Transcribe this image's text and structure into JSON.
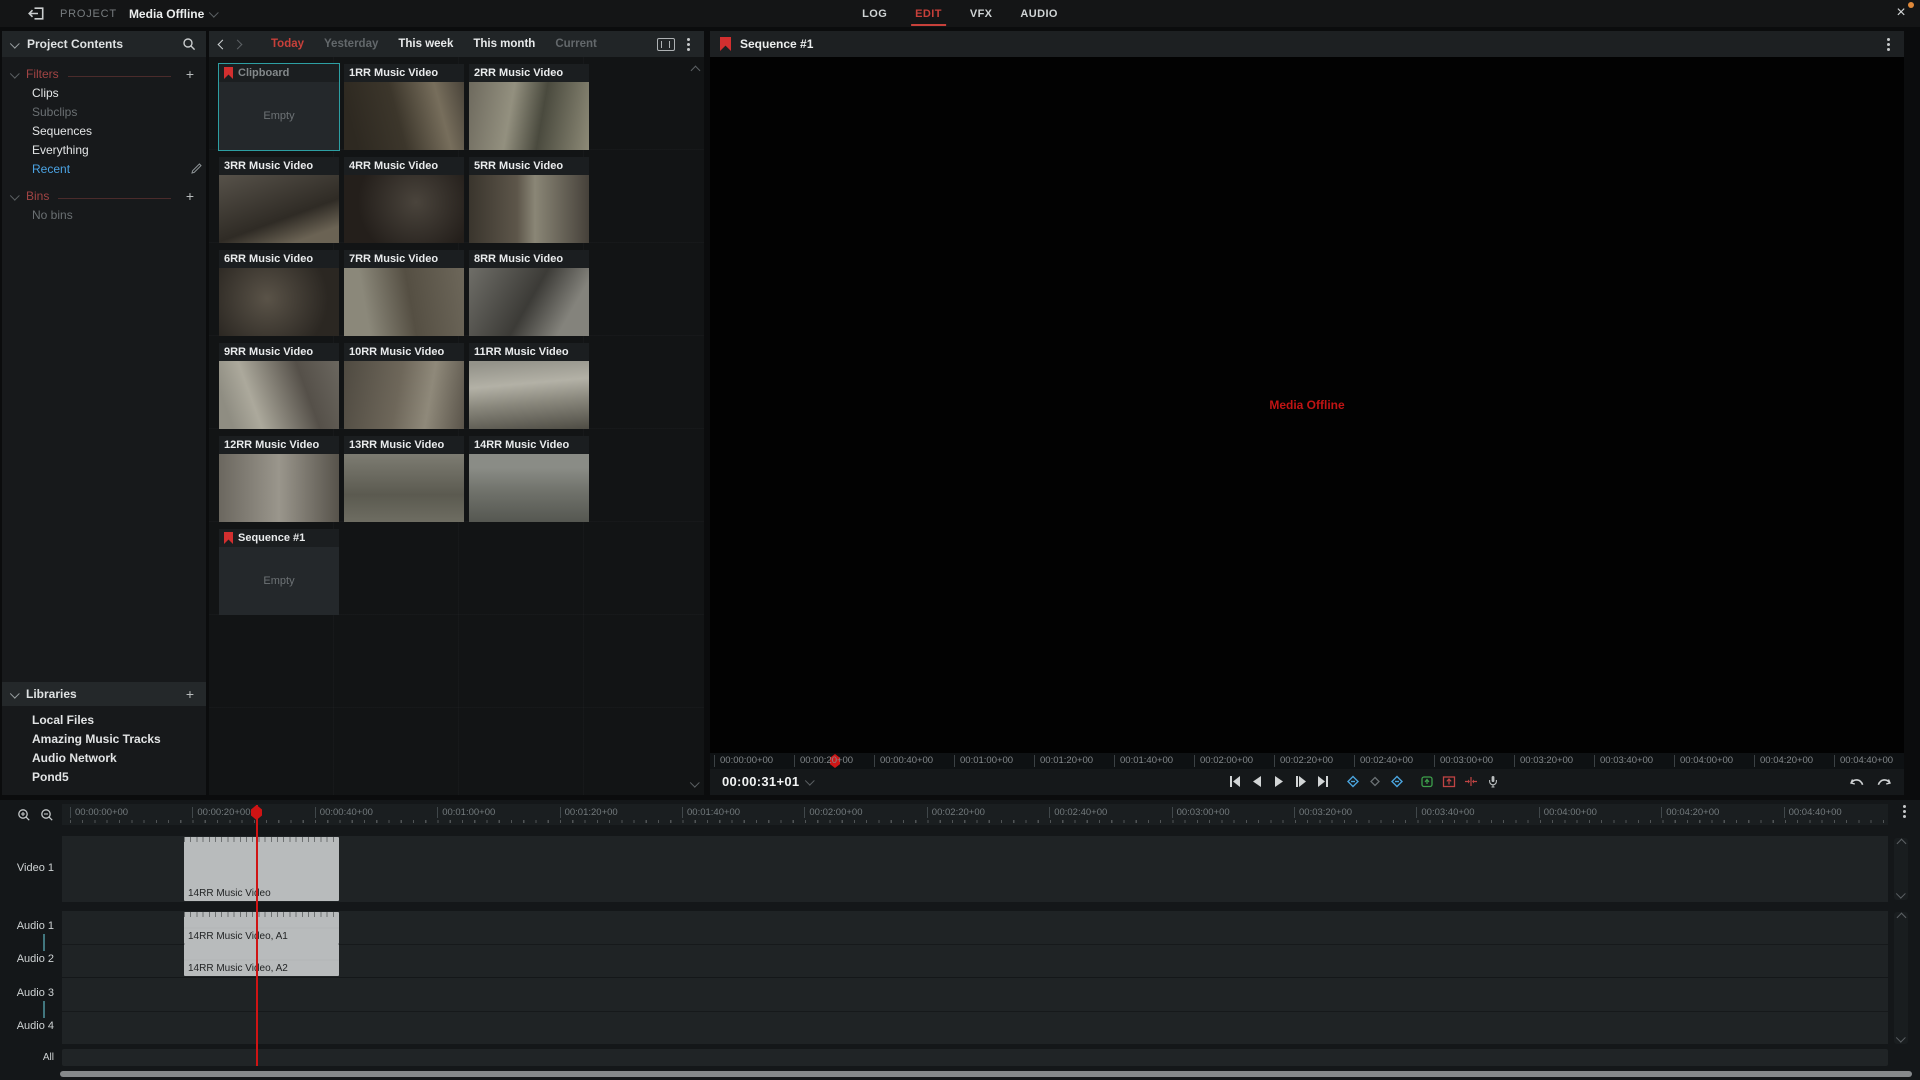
{
  "colors": {
    "accent_red": "#c7403a",
    "bookmark_red": "#d22f2f",
    "selected_teal": "#2d9fa3",
    "recent_blue": "#4ba3e3",
    "offline_red": "#c01414",
    "playhead_red": "#cf1414",
    "notification_orange": "#e0893a"
  },
  "topbar": {
    "project_label": "PROJECT",
    "project_name": "Media Offline",
    "tabs": [
      {
        "label": "LOG",
        "state": "normal"
      },
      {
        "label": "EDIT",
        "state": "active"
      },
      {
        "label": "VFX",
        "state": "normal"
      },
      {
        "label": "AUDIO",
        "state": "normal"
      }
    ],
    "close_label": "×"
  },
  "sidebar": {
    "title": "Project Contents",
    "filters": {
      "title": "Filters",
      "items": [
        {
          "label": "Clips",
          "state": "normal"
        },
        {
          "label": "Subclips",
          "state": "dim"
        },
        {
          "label": "Sequences",
          "state": "normal"
        },
        {
          "label": "Everything",
          "state": "normal"
        },
        {
          "label": "Recent",
          "state": "selected"
        }
      ]
    },
    "bins": {
      "title": "Bins",
      "empty_label": "No bins"
    },
    "libraries": {
      "title": "Libraries",
      "items": [
        "Local Files",
        "Amazing Music Tracks",
        "Audio Network",
        "Pond5"
      ]
    }
  },
  "browser": {
    "tabs": [
      {
        "label": "Today",
        "state": "active"
      },
      {
        "label": "Yesterday",
        "state": "dim"
      },
      {
        "label": "This week",
        "state": "normal"
      },
      {
        "label": "This month",
        "state": "normal"
      },
      {
        "label": "Current",
        "state": "dim"
      }
    ],
    "tiles": [
      {
        "title": "Clipboard",
        "kind": "empty",
        "selected": true,
        "bookmark": true,
        "empty_label": "Empty"
      },
      {
        "title": "1RR Music Video",
        "kind": "clip",
        "thumb": 1
      },
      {
        "title": "2RR Music Video",
        "kind": "clip",
        "thumb": 2
      },
      {
        "title": "3RR Music Video",
        "kind": "clip",
        "thumb": 3
      },
      {
        "title": "4RR Music Video",
        "kind": "clip",
        "thumb": 4
      },
      {
        "title": "5RR Music Video",
        "kind": "clip",
        "thumb": 5
      },
      {
        "title": "6RR Music Video",
        "kind": "clip",
        "thumb": 6
      },
      {
        "title": "7RR Music Video",
        "kind": "clip",
        "thumb": 7
      },
      {
        "title": "8RR Music Video",
        "kind": "clip",
        "thumb": 8
      },
      {
        "title": "9RR Music Video",
        "kind": "clip",
        "thumb": 9
      },
      {
        "title": "10RR Music Video",
        "kind": "clip",
        "thumb": 10
      },
      {
        "title": "11RR Music Video",
        "kind": "clip",
        "thumb": 11
      },
      {
        "title": "12RR Music Video",
        "kind": "clip",
        "thumb": 12
      },
      {
        "title": "13RR Music Video",
        "kind": "clip",
        "thumb": 13
      },
      {
        "title": "14RR Music Video",
        "kind": "clip",
        "thumb": 14
      },
      {
        "title": "Sequence #1",
        "kind": "empty",
        "selected": false,
        "bookmark": true,
        "empty_label": "Empty"
      }
    ]
  },
  "viewer": {
    "title": "Sequence #1",
    "offline_text": "Media Offline",
    "position_timecode": "00:00:31+01",
    "ruler_labels": [
      "00:00:00+00",
      "00:00:20+00",
      "00:00:40+00",
      "00:01:00+00",
      "00:01:20+00",
      "00:01:40+00",
      "00:02:00+00",
      "00:02:20+00",
      "00:02:40+00",
      "00:03:00+00",
      "00:03:20+00",
      "00:03:40+00",
      "00:04:00+00",
      "00:04:20+00",
      "00:04:40+00"
    ],
    "transport_icons": [
      "go-to-start",
      "play-backward",
      "play",
      "play-forward",
      "go-to-end",
      "mark-in",
      "mark-point",
      "mark-out",
      "make-subclip",
      "insert-edit",
      "remove-and-close-gap",
      "voiceover-mic"
    ],
    "history_icons": [
      "undo",
      "redo"
    ]
  },
  "timeline": {
    "ruler_labels": [
      "00:00:00+00",
      "00:00:20+00",
      "00:00:40+00",
      "00:01:00+00",
      "00:01:20+00",
      "00:01:40+00",
      "00:02:00+00",
      "00:02:20+00",
      "00:02:40+00",
      "00:03:00+00",
      "00:03:20+00",
      "00:03:40+00",
      "00:04:00+00",
      "00:04:20+00",
      "00:04:40+00"
    ],
    "tracks": [
      "Video 1",
      "Audio 1",
      "Audio 2",
      "Audio 3",
      "Audio 4"
    ],
    "all_label": "All",
    "clips": {
      "video1": "14RR Music Video",
      "audio1": "14RR Music Video, A1",
      "audio2": "14RR Music Video, A2"
    }
  }
}
